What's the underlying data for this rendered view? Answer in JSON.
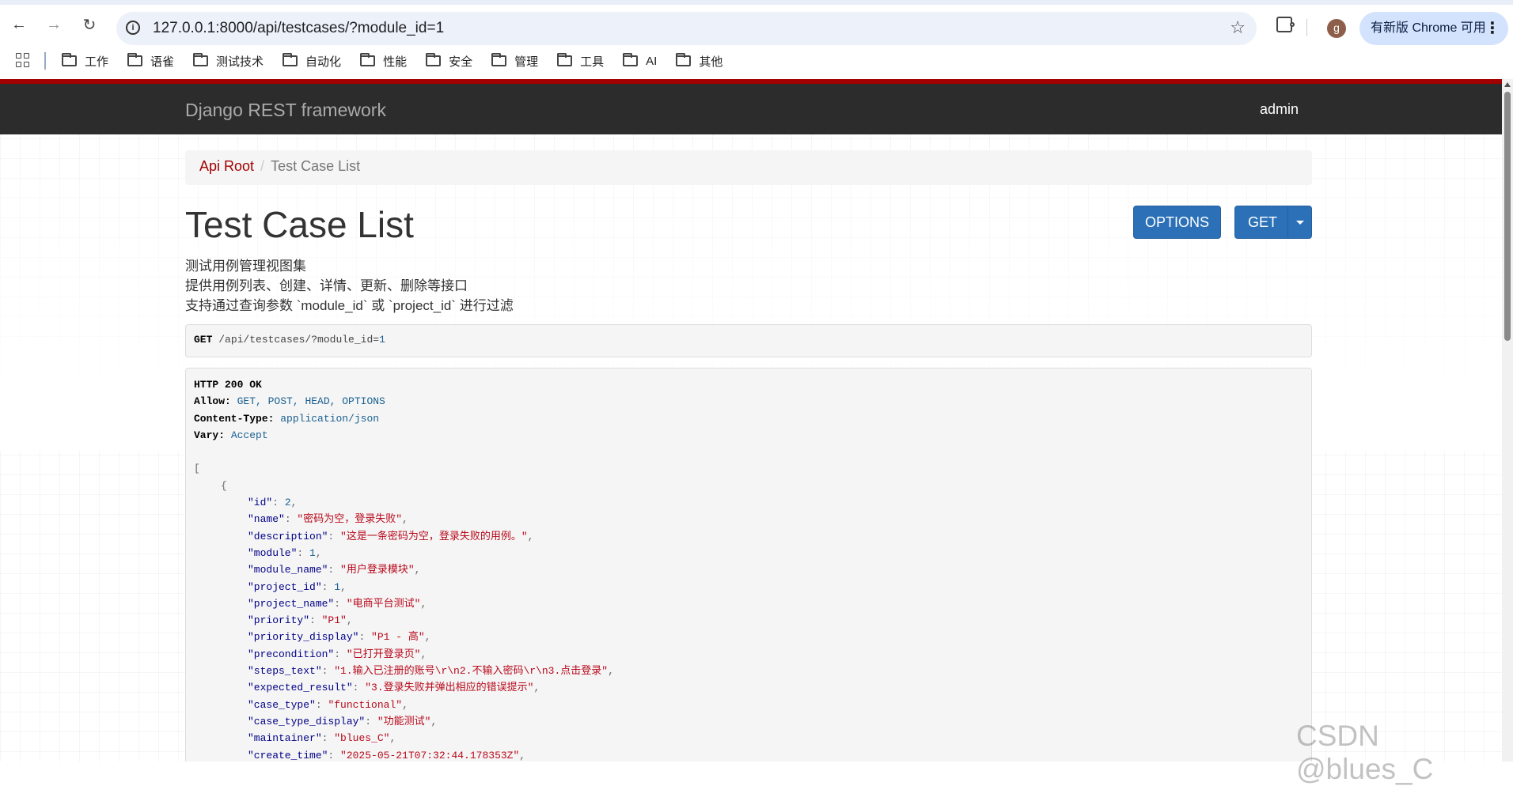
{
  "browser": {
    "url": "127.0.0.1:8000/api/testcases/?module_id=1",
    "avatar_letter": "g",
    "update_label": "有新版 Chrome 可用"
  },
  "bookmarks": [
    "工作",
    "语雀",
    "测试技术",
    "自动化",
    "性能",
    "安全",
    "管理",
    "工具",
    "AI",
    "其他"
  ],
  "navbar": {
    "brand": "Django REST framework",
    "user": "admin"
  },
  "breadcrumb": {
    "root": "Api Root",
    "divider": "/",
    "current": "Test Case List"
  },
  "title": "Test Case List",
  "buttons": {
    "options": "OPTIONS",
    "get": "GET"
  },
  "description": [
    "测试用例管理视图集",
    "提供用例列表、创建、详情、更新、删除等接口",
    "支持通过查询参数 `module_id` 或 `project_id` 进行过滤"
  ],
  "request": {
    "method": "GET",
    "path": "/api/testcases/?module_id=",
    "query_value": "1"
  },
  "response": {
    "status": "HTTP 200 OK",
    "headers": [
      {
        "key": "Allow",
        "value": "GET, POST, HEAD, OPTIONS"
      },
      {
        "key": "Content-Type",
        "value": "application/json"
      },
      {
        "key": "Vary",
        "value": "Accept"
      }
    ],
    "open_bracket": "[",
    "open_brace": "{",
    "fields": [
      {
        "key": "\"id\"",
        "value": "2",
        "type": "num"
      },
      {
        "key": "\"name\"",
        "value": "\"密码为空，登录失败\"",
        "type": "str"
      },
      {
        "key": "\"description\"",
        "value": "\"这是一条密码为空，登录失败的用例。\"",
        "type": "str"
      },
      {
        "key": "\"module\"",
        "value": "1",
        "type": "num"
      },
      {
        "key": "\"module_name\"",
        "value": "\"用户登录模块\"",
        "type": "str"
      },
      {
        "key": "\"project_id\"",
        "value": "1",
        "type": "num"
      },
      {
        "key": "\"project_name\"",
        "value": "\"电商平台测试\"",
        "type": "str"
      },
      {
        "key": "\"priority\"",
        "value": "\"P1\"",
        "type": "str"
      },
      {
        "key": "\"priority_display\"",
        "value": "\"P1 - 高\"",
        "type": "str"
      },
      {
        "key": "\"precondition\"",
        "value": "\"已打开登录页\"",
        "type": "str"
      },
      {
        "key": "\"steps_text\"",
        "value": "\"1.输入已注册的账号\\r\\n2.不输入密码\\r\\n3.点击登录\"",
        "type": "str"
      },
      {
        "key": "\"expected_result\"",
        "value": "\"3.登录失败并弹出相应的错误提示\"",
        "type": "str"
      },
      {
        "key": "\"case_type\"",
        "value": "\"functional\"",
        "type": "str"
      },
      {
        "key": "\"case_type_display\"",
        "value": "\"功能测试\"",
        "type": "str"
      },
      {
        "key": "\"maintainer\"",
        "value": "\"blues_C\"",
        "type": "str"
      },
      {
        "key": "\"create_time\"",
        "value": "\"2025-05-21T07:32:44.178353Z\"",
        "type": "str"
      }
    ]
  },
  "watermark": "CSDN @blues_C"
}
